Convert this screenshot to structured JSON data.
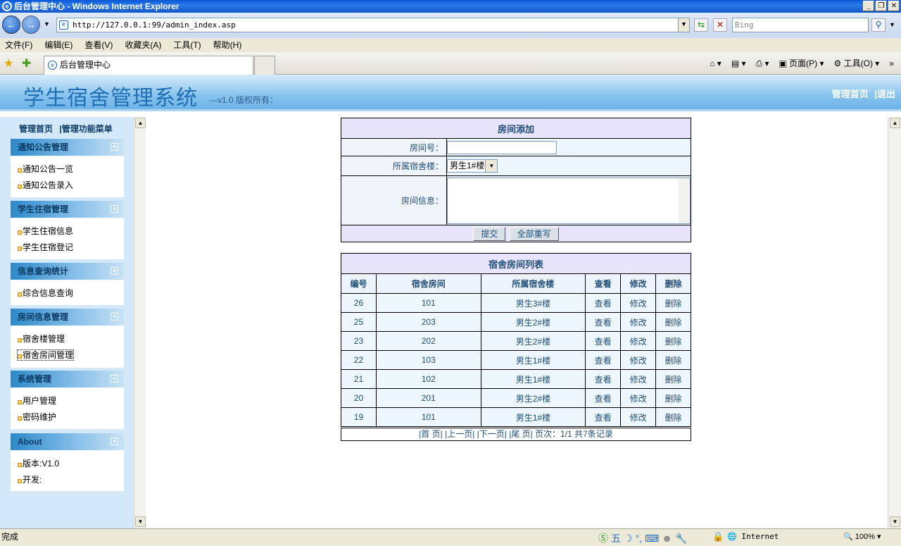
{
  "browser": {
    "window_title": "后台管理中心 - Windows Internet Explorer",
    "address": "http://127.0.0.1:99/admin_index.asp",
    "search_placeholder": "Bing",
    "menu": [
      "文件(F)",
      "编辑(E)",
      "查看(V)",
      "收藏夹(A)",
      "工具(T)",
      "帮助(H)"
    ],
    "tab_title": "后台管理中心",
    "tools": [
      "页面(P)",
      "工具(O)"
    ],
    "status_text": "完成",
    "zone": "Internet",
    "zoom": "100%"
  },
  "header": {
    "title": "学生宿舍管理系统",
    "version": "---v1.0 版权所有：",
    "link_home": "管理首页",
    "link_logout": "|退出"
  },
  "sidebar": {
    "nav_home": "管理首页",
    "nav_menu": "|管理功能菜单",
    "panels": [
      {
        "title": "通知公告管理",
        "items": [
          "通知公告一览",
          "通知公告录入"
        ]
      },
      {
        "title": "学生住宿管理",
        "items": [
          "学生住宿信息",
          "学生住宿登记"
        ]
      },
      {
        "title": "信息查询统计",
        "items": [
          "综合信息查询"
        ]
      },
      {
        "title": "房间信息管理",
        "items": [
          "宿舍楼管理",
          "宿舍房间管理"
        ]
      },
      {
        "title": "系统管理",
        "items": [
          "用户管理",
          "密码维护"
        ]
      },
      {
        "title": "About",
        "items": [
          "版本:V1.0",
          "开发:"
        ]
      }
    ]
  },
  "form": {
    "title": "房间添加",
    "room_no_label": "房间号：",
    "building_label": "所属宿舍楼：",
    "building_selected": "男生1#楼",
    "info_label": "房间信息：",
    "submit": "提交",
    "reset": "全部重写"
  },
  "list": {
    "title": "宿舍房间列表",
    "columns": [
      "编号",
      "宿舍房间",
      "所属宿舍楼",
      "查看",
      "修改",
      "删除"
    ],
    "rows": [
      [
        "26",
        "101",
        "男生3#楼",
        "查看",
        "修改",
        "删除"
      ],
      [
        "25",
        "203",
        "男生2#楼",
        "查看",
        "修改",
        "删除"
      ],
      [
        "23",
        "202",
        "男生2#楼",
        "查看",
        "修改",
        "删除"
      ],
      [
        "22",
        "103",
        "男生1#楼",
        "查看",
        "修改",
        "删除"
      ],
      [
        "21",
        "102",
        "男生1#楼",
        "查看",
        "修改",
        "删除"
      ],
      [
        "20",
        "201",
        "男生2#楼",
        "查看",
        "修改",
        "删除"
      ],
      [
        "19",
        "101",
        "男生1#楼",
        "查看",
        "修改",
        "删除"
      ]
    ],
    "pager": "|首 页| |上一页| |下一页| |尾 页| 页次：1/1 共7条记录"
  }
}
